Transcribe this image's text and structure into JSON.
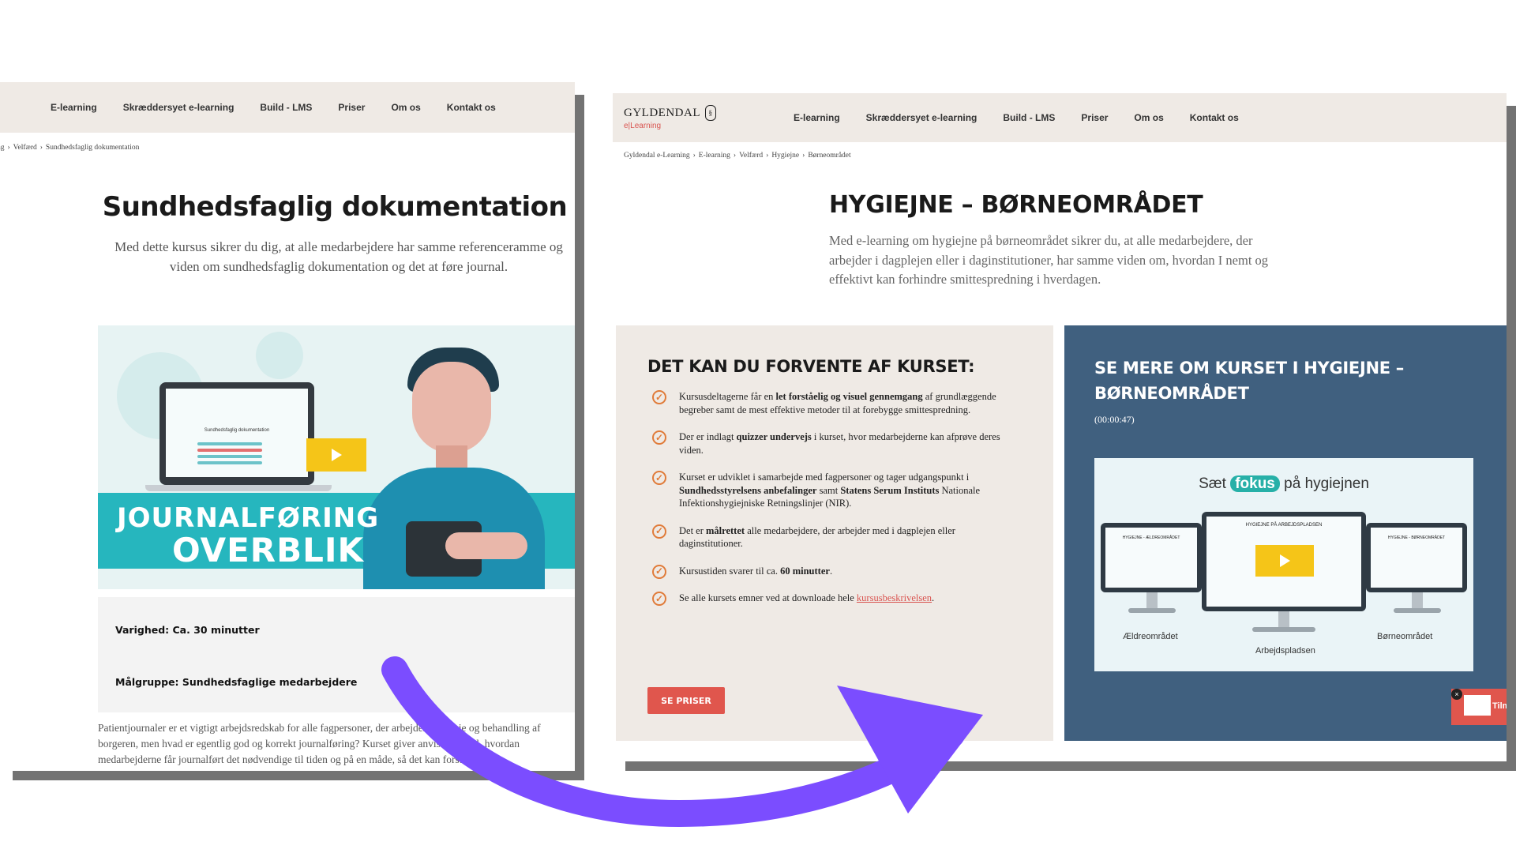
{
  "left": {
    "nav": [
      "E-learning",
      "Skræddersyet e-learning",
      "Build - LMS",
      "Priser",
      "Om os",
      "Kontakt os"
    ],
    "breadcrumb": [
      "ng",
      "Velfærd",
      "Sundhedsfaglig dokumentation"
    ],
    "title": "Sundhedsfaglig dokumentation",
    "intro": "Med dette kursus sikrer du dig, at alle medarbejdere har samme referenceramme og viden om sundhedsfaglig dokumentation og det at føre journal.",
    "hero": {
      "line1": "JOURNALFØRING",
      "line2": "OVERBLIK",
      "mini_title": "Sundhedsfaglig dokumentation"
    },
    "facts": [
      "Varighed: Ca. 30 minutter",
      "Målgruppe: Sundhedsfaglige medarbejdere"
    ],
    "body": "Patientjournaler er et vigtigt arbejdsredskab for alle fagpersoner, der arbejder om pleje og behandling af borgeren, men hvad er egentlig god og korrekt journalføring? Kurset giver anvisninger til, hvordan medarbejderne får journalført det nødvendige til tiden og på en måde, så det kan forstås"
  },
  "right": {
    "logo": {
      "main": "GYLDENDAL",
      "sub": "e|Learning"
    },
    "nav": [
      "E-learning",
      "Skræddersyet e-learning",
      "Build - LMS",
      "Priser",
      "Om os",
      "Kontakt os"
    ],
    "breadcrumb": [
      "Gyldendal e-Learning",
      "E-learning",
      "Velfærd",
      "Hygiejne",
      "Børneområdet"
    ],
    "title": "HYGIEJNE – BØRNEOMRÅDET",
    "intro": "Med e-learning om hygiejne på børneområdet sikrer du, at alle medarbejdere, der arbejder i dagplejen eller i daginstitutioner, har samme viden om, hvordan I nemt og effektivt kan forhindre smittespredning i hverdagen.",
    "expect": {
      "heading": "DET KAN DU FORVENTE AF KURSET:",
      "items": [
        {
          "pre": "Kursusdeltagerne får en ",
          "bold": "let forståelig og visuel gennemgang",
          "post": " af grundlæggende begreber samt de mest effektive metoder til at forebygge smittespredning."
        },
        {
          "pre": "Der er indlagt ",
          "bold": "quizzer undervejs",
          "post": " i kurset, hvor medarbejderne kan afprøve deres viden."
        },
        {
          "pre": "Kurset er udviklet i samarbejde med fagpersoner og tager udgangspunkt i ",
          "bold": "Sundhedsstyrelsens anbefalinger",
          "mid": " samt ",
          "bold2": "Statens Serum Instituts",
          "post": " Nationale Infektionshygiejniske Retningslinjer (NIR)."
        },
        {
          "pre": "Det er ",
          "bold": "målrettet",
          "post": " alle medarbejdere, der arbejder med i dagplejen eller daginstitutioner."
        },
        {
          "pre": "Kursustiden svarer til ca. ",
          "bold": "60 minutter",
          "post": "."
        },
        {
          "pre": "Se alle kursets emner ved at downloade hele ",
          "link": "kursusbeskrivelsen",
          "post": "."
        }
      ],
      "button": "SE PRISER"
    },
    "video": {
      "heading": "SE MERE OM KURSET I HYGIEJNE – BØRNEOMRÅDET",
      "duration": "(00:00:47)",
      "title_pre": "Sæt ",
      "title_fokus": "fokus",
      "title_post": " på hygiejnen",
      "labels": [
        "Ældreområdet",
        "Arbejdspladsen",
        "Børneområdet"
      ],
      "screen_titles": [
        "HYGIEJNE - ÆLDREOMRÅDET",
        "HYGIEJNE PÅ ARBEJDSPLADSEN",
        "HYGIEJNE - BØRNEOMRÅDET"
      ]
    },
    "widget": {
      "text": "Tilm",
      "close": "×"
    }
  },
  "colors": {
    "nav_bg": "#efeae5",
    "accent_red": "#e0564d",
    "check_orange": "#e07b39",
    "video_panel": "#40607f",
    "hero_teal": "#26b6be",
    "arrow_purple": "#7b4dff"
  }
}
